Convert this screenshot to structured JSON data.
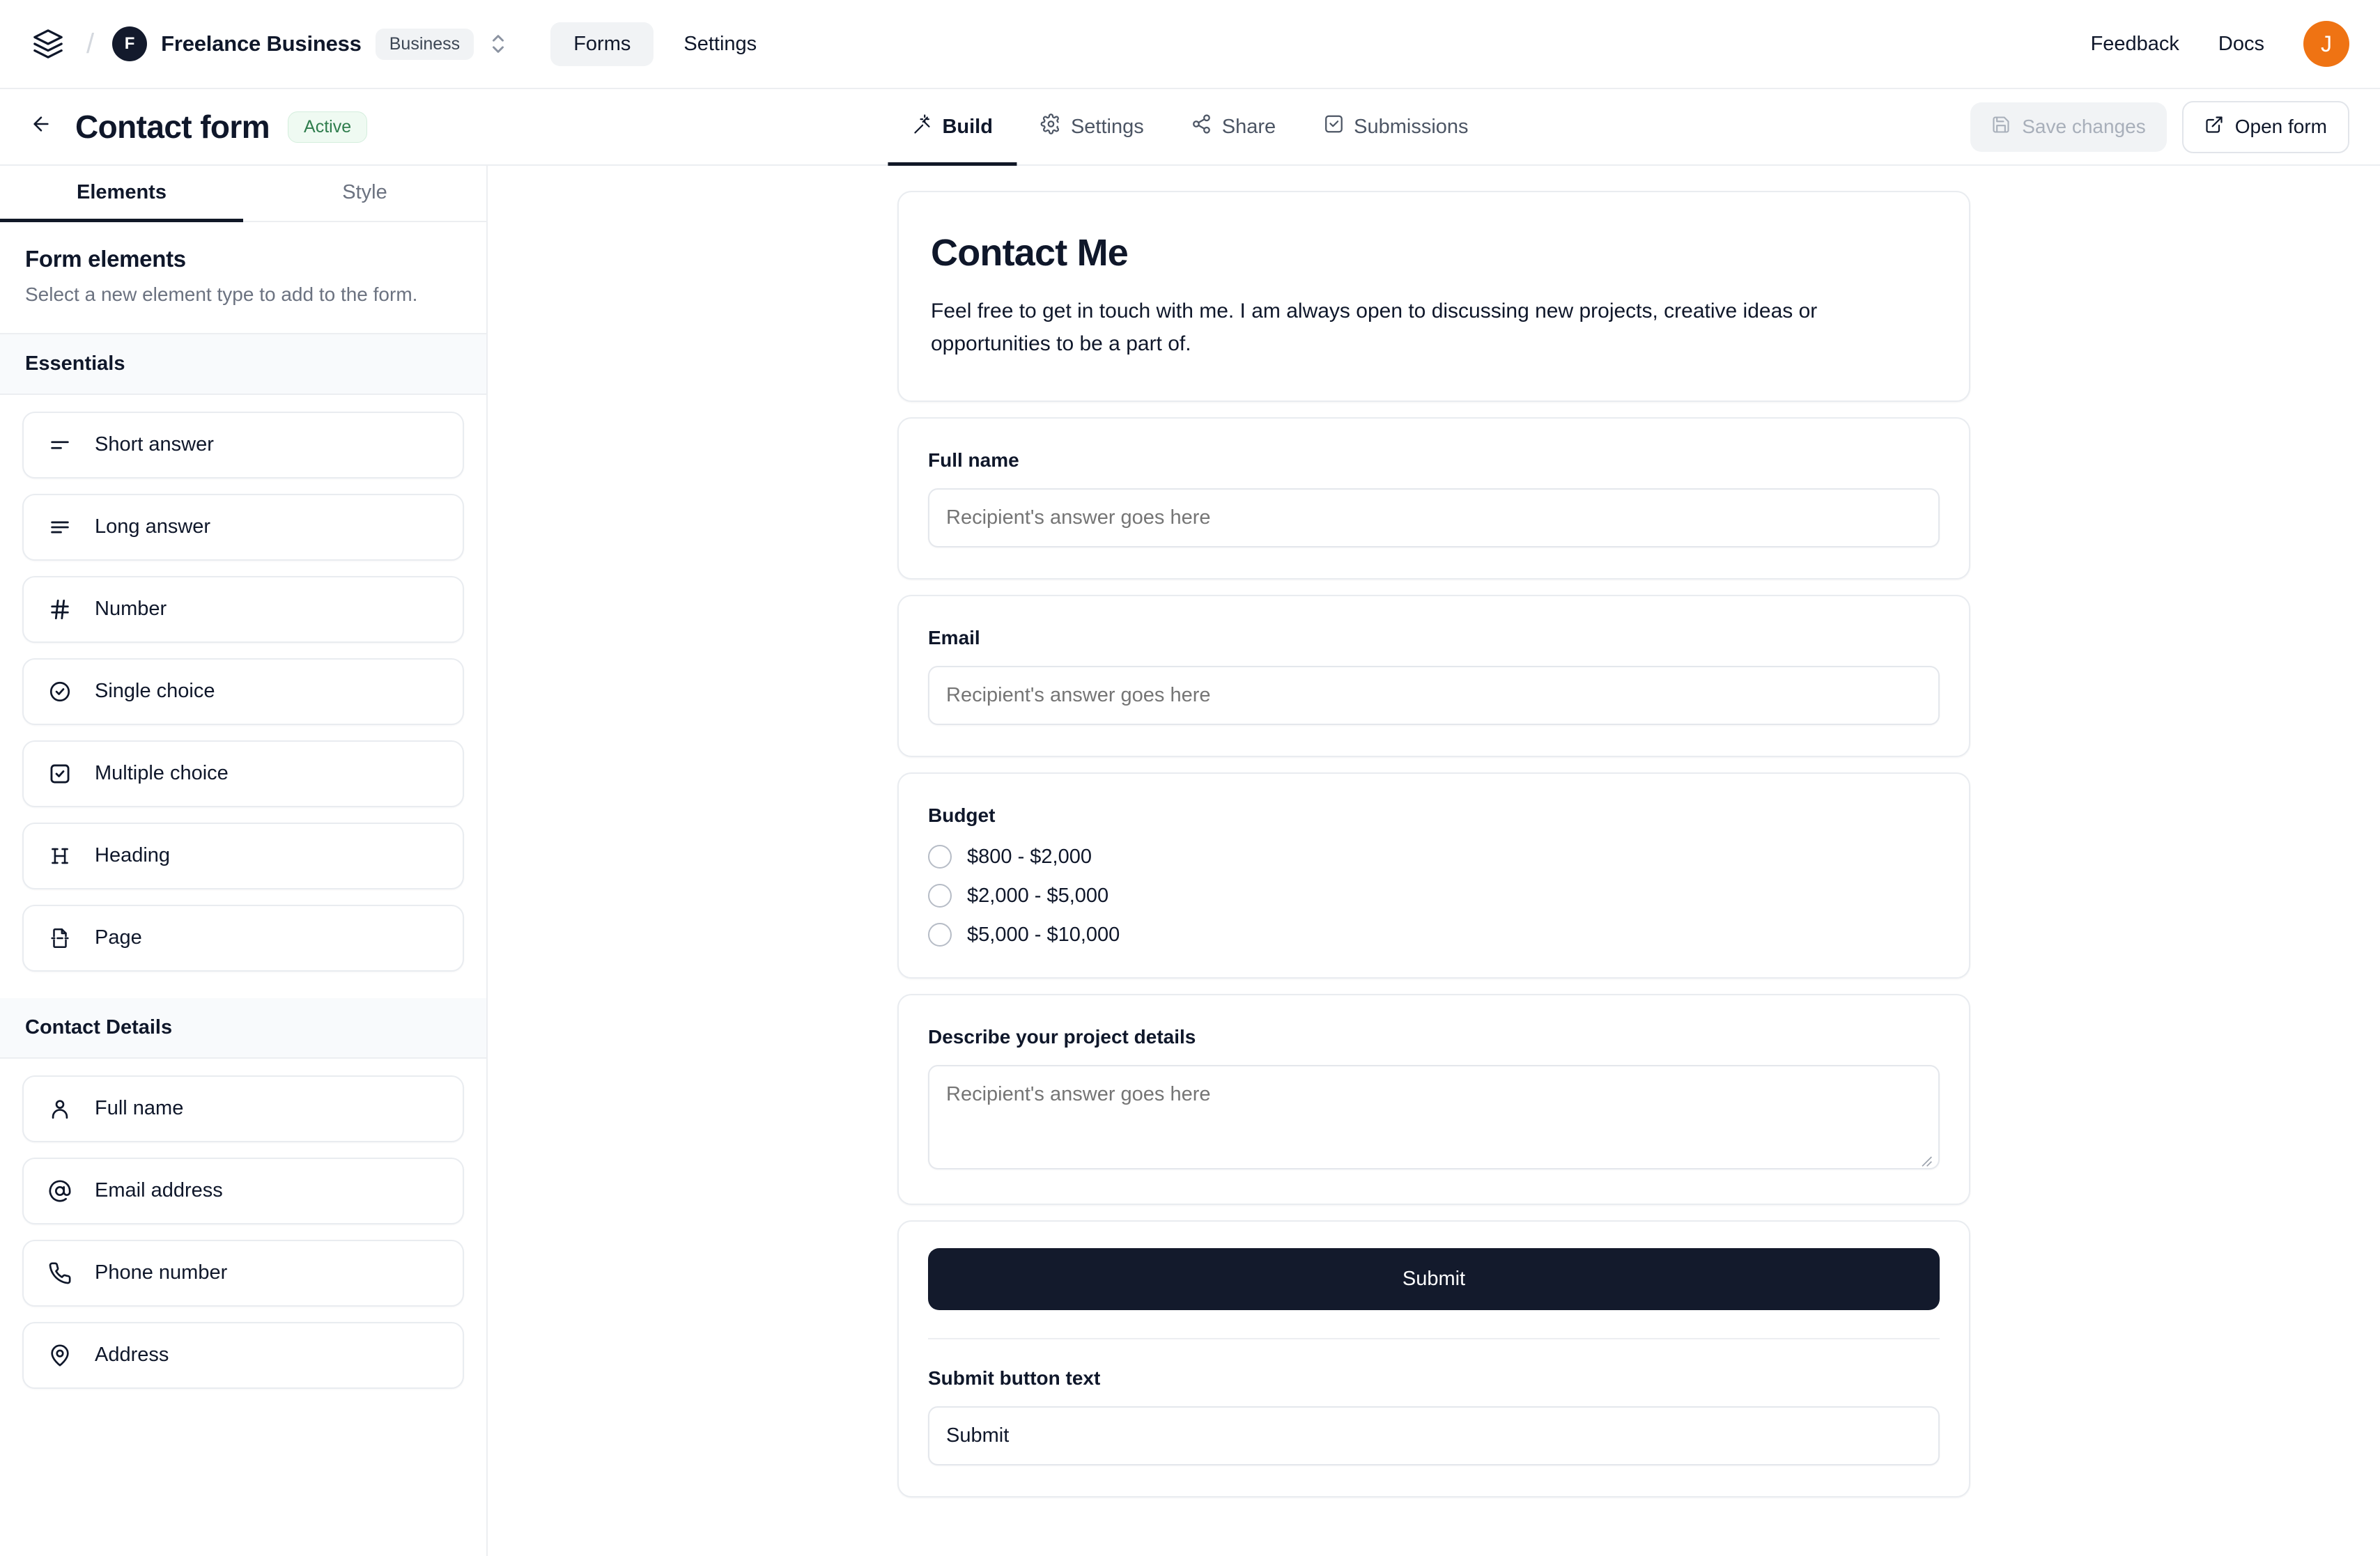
{
  "topbar": {
    "logo_icon": "layers-icon",
    "separator": "/",
    "org_initial": "F",
    "org_name": "Freelance Business",
    "plan_badge": "Business",
    "switcher_icon": "chevron-up-down-icon",
    "nav": [
      {
        "label": "Forms",
        "active": true
      },
      {
        "label": "Settings",
        "active": false
      }
    ],
    "feedback_label": "Feedback",
    "docs_label": "Docs",
    "user_initial": "J",
    "user_avatar_color": "#ef7313"
  },
  "subheader": {
    "back_icon": "arrow-left-icon",
    "form_title": "Contact form",
    "status_badge": "Active",
    "status_color": "#2f7d4d",
    "tabs": [
      {
        "label": "Build",
        "icon": "wand-icon",
        "active": true
      },
      {
        "label": "Settings",
        "icon": "gear-icon",
        "active": false
      },
      {
        "label": "Share",
        "icon": "share-icon",
        "active": false
      },
      {
        "label": "Submissions",
        "icon": "inbox-check-icon",
        "active": false
      }
    ],
    "save_label": "Save changes",
    "save_icon": "floppy-disk-icon",
    "open_form_label": "Open form",
    "open_form_icon": "external-link-icon"
  },
  "sidebar": {
    "tabs": [
      {
        "label": "Elements",
        "active": true
      },
      {
        "label": "Style",
        "active": false
      }
    ],
    "panel_title": "Form elements",
    "panel_subtitle": "Select a new element type to add to the form.",
    "groups": [
      {
        "title": "Essentials",
        "items": [
          {
            "label": "Short answer",
            "icon": "short-answer-icon"
          },
          {
            "label": "Long answer",
            "icon": "long-answer-icon"
          },
          {
            "label": "Number",
            "icon": "hash-icon"
          },
          {
            "label": "Single choice",
            "icon": "radio-check-circle-icon"
          },
          {
            "label": "Multiple choice",
            "icon": "checkbox-check-icon"
          },
          {
            "label": "Heading",
            "icon": "heading-h-icon"
          },
          {
            "label": "Page",
            "icon": "page-break-icon"
          }
        ]
      },
      {
        "title": "Contact Details",
        "items": [
          {
            "label": "Full name",
            "icon": "user-icon"
          },
          {
            "label": "Email address",
            "icon": "at-sign-icon"
          },
          {
            "label": "Phone number",
            "icon": "phone-icon"
          },
          {
            "label": "Address",
            "icon": "map-pin-icon"
          }
        ]
      }
    ]
  },
  "form": {
    "heading": "Contact Me",
    "description": "Feel free to get in touch with me. I am always open to discussing new projects, creative ideas or opportunities to be a part of.",
    "fields": [
      {
        "label": "Full name",
        "type": "short_answer",
        "placeholder": "Recipient's answer goes here"
      },
      {
        "label": "Email",
        "type": "short_answer",
        "placeholder": "Recipient's answer goes here"
      }
    ],
    "budget": {
      "label": "Budget",
      "options": [
        "$800 - $2,000",
        "$2,000 - $5,000",
        "$5,000 - $10,000"
      ]
    },
    "project_details": {
      "label": "Describe your project details",
      "placeholder": "Recipient's answer goes here"
    },
    "submit": {
      "button_label": "Submit",
      "setting_label": "Submit button text",
      "setting_value": "Submit",
      "button_color": "#131a2c"
    }
  }
}
